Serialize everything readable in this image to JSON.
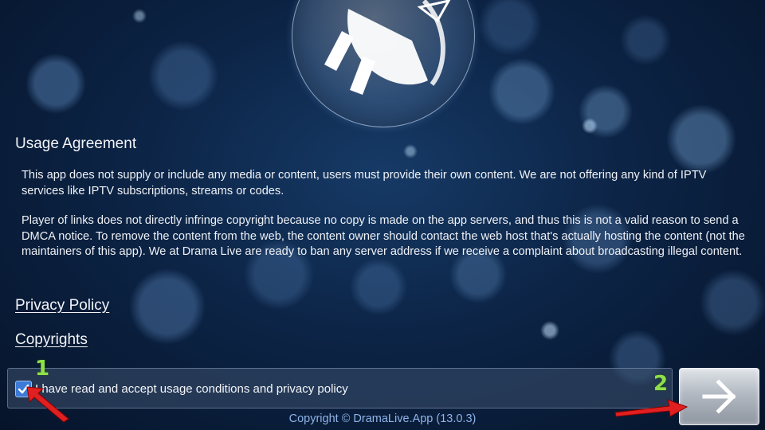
{
  "agreement": {
    "title": "Usage Agreement",
    "paragraph_1": "This app does not supply or include any media or content, users must provide their own content. We are not offering any kind of IPTV services like IPTV subscriptions, streams or codes.",
    "paragraph_2": "Player of links does not directly infringe copyright because no copy is made on the app servers, and thus this is not a valid reason to send a DMCA notice. To remove the content from the web, the content owner should contact the web host that's actually hosting the content (not the maintainers of this app). We at Drama Live are ready to ban any server address if we receive a complaint about broadcasting illegal content."
  },
  "links": {
    "privacy_policy": "Privacy Policy",
    "copyrights": "Copyrights"
  },
  "accept": {
    "checked": true,
    "label": "I have read and accept usage conditions and privacy policy"
  },
  "next_button": {
    "icon": "arrow-right-icon"
  },
  "footer": {
    "copyright": "Copyright © DramaLive.App (13.0.3)"
  },
  "annotations": {
    "marker_1": "1",
    "marker_2": "2",
    "arrow_color": "#e02020",
    "marker_color": "#8ee04a"
  },
  "logo": {
    "icon": "plug-logo-icon"
  }
}
